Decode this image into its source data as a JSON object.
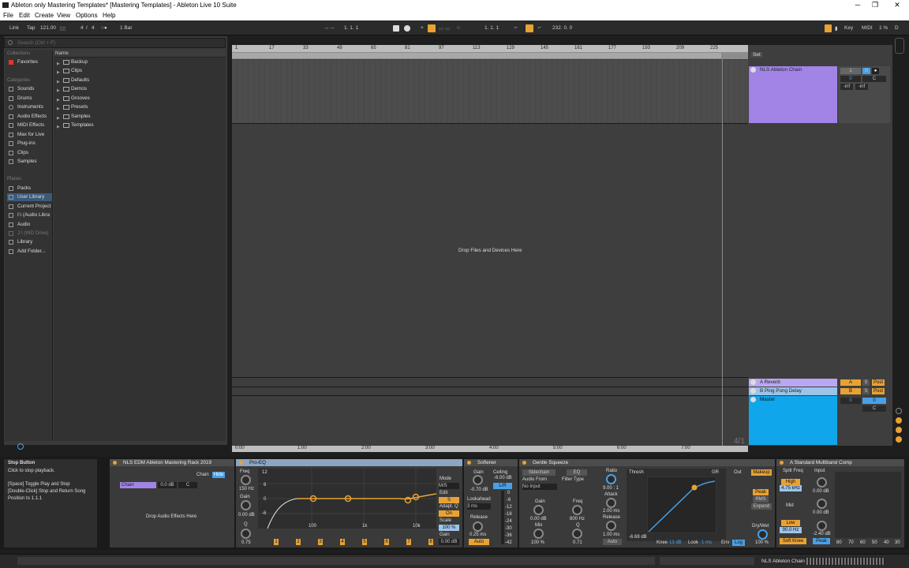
{
  "window": {
    "title": "Ableton only Mastering Templates*  [Mastering Templates] - Ableton Live 10 Suite",
    "minimize": "─",
    "restore": "❐",
    "close": "✕"
  },
  "menu": [
    "File",
    "Edit",
    "Create",
    "View",
    "Options",
    "Help"
  ],
  "transport": {
    "link": "Link",
    "tap": "Tap",
    "tempo": "121.00",
    "sig_num": "4",
    "sig_den": "4",
    "quantize": "1 Bar",
    "position": "1.    1.    1",
    "loop_start": "1.    1.    1",
    "loop_length": "232.    0.    0",
    "key": "Key",
    "midi": "MIDI",
    "cpu": "1 %",
    "d": "D"
  },
  "browser": {
    "search_placeholder": "Search (Ctrl + F)",
    "collections_header": "Collections",
    "favorites": "Favorites",
    "categories_header": "Categories",
    "categories": [
      "Sounds",
      "Drums",
      "Instruments",
      "Audio Effects",
      "MIDI Effects",
      "Max for Live",
      "Plug-ins",
      "Clips",
      "Samples"
    ],
    "places_header": "Places",
    "places": [
      "Packs",
      "User Library",
      "Current Project",
      "I:\\ (Audio Libra",
      "Audio",
      "J:\\ (WD Drive)",
      "Library",
      "Add Folder..."
    ],
    "name_header": "Name",
    "folders": [
      "Backup",
      "Clips",
      "Defaults",
      "Demos",
      "Grooves",
      "Presets",
      "Samples",
      "Templates"
    ]
  },
  "arrangement": {
    "ruler": [
      "1",
      "17",
      "33",
      "49",
      "65",
      "81",
      "97",
      "113",
      "129",
      "145",
      "161",
      "177",
      "193",
      "209",
      "225"
    ],
    "times": [
      "0:00",
      "1:00",
      "2:00",
      "3:00",
      "4:00",
      "5:00",
      "6:00",
      "7:00"
    ],
    "drop_text": "Drop Files and Devices Here",
    "time_sig": "4/1"
  },
  "tracks": {
    "set_label": "Set",
    "main": "NLS Ableton Chain",
    "return_a": "A Reverb",
    "return_b": "B Ping Pong Delay",
    "master": "Master",
    "vol_a": "0",
    "pan_c": "C",
    "inf1": "-inf",
    "inf2": "-inf",
    "send_a": "A",
    "send_b": "B",
    "solo": "S",
    "post": "Post",
    "master_vol": "0",
    "master_pan": "C",
    "track_num": "1",
    "track_s": "S"
  },
  "info": {
    "title": "Stop Button",
    "line1": "Click to stop playback.",
    "line2": "[Space] Toggle Play and Stop",
    "line3": "[Double-Click] Stop and Return Song",
    "line4": "Position to 1.1.1"
  },
  "rack": {
    "name": "NLS EDM Ableton Mastering Rack 2019",
    "chain_label": "Chain",
    "hide": "Hide",
    "chain_name": "Chain",
    "chain_db": "0.0 dB",
    "chain_pan": "C",
    "drop_text": "Drop Audio Effects Here"
  },
  "eq": {
    "name": "Pro-EQ",
    "freq_label": "Freq",
    "freq": "150 Hz",
    "gain_label": "Gain",
    "gain": "0.00 dB",
    "q_label": "Q",
    "q": "0.75",
    "db_ticks": [
      "12",
      "6",
      "0",
      "-6",
      "-12"
    ],
    "hz_ticks": [
      "100",
      "1k",
      "10k"
    ],
    "mode_label": "Mode",
    "mode": "M/S",
    "edit_label": "Edit",
    "edit": "S",
    "adapt_label": "Adapt. Q",
    "adapt": "On",
    "scale_label": "Scale",
    "scale": "100 %",
    "gain2_label": "Gain",
    "gain2": "0.00 dB",
    "bands": [
      "1",
      "2",
      "3",
      "4",
      "5",
      "6",
      "7",
      "8"
    ]
  },
  "softener": {
    "name": "Softener",
    "gain_label": "Gain",
    "gain": "-0.70 dB",
    "ceiling_label": "Ceiling",
    "ceiling": "-6.00 dB",
    "lr": "L/R",
    "lookahead_label": "Lookahead",
    "lookahead": "3 ms",
    "release_label": "Release",
    "release": "0.25 ms",
    "auto": "Auto",
    "scale": [
      "0",
      "-6",
      "-12",
      "-18",
      "-24",
      "-30",
      "-36",
      "-42"
    ]
  },
  "squeeze": {
    "name": "Gentle Squeeze",
    "sidechain": "Sidechain",
    "eq": "EQ",
    "audio_from_label": "Audio From",
    "audio_from": "No Input",
    "filter_label": "Filter Type",
    "gain_label": "Gain",
    "gain": "0.00 dB",
    "mix_label": "Mix",
    "mix": "100 %",
    "freq_label": "Freq",
    "freq": "800 Hz",
    "q_label": "Q",
    "q": "0.71",
    "ratio_label": "Ratio",
    "ratio": "9.00 : 1",
    "attack_label": "Attack",
    "attack": "2.00 ms",
    "release_label": "Release",
    "release": "1.00 ms",
    "auto": "Auto",
    "thresh_label": "Thresh",
    "gr_label": "GR",
    "out_label": "Out",
    "thresh": "-6.68 dB",
    "knee_label": "Knee",
    "knee": "13 dB",
    "look_label": "Look",
    "look": "1 ms",
    "env_label": "Env",
    "env": "Log",
    "makeup": "Makeup",
    "peak": "Peak",
    "rms": "RMS",
    "expand": "Expand",
    "drywet_label": "Dry/Wet",
    "drywet": "100 %"
  },
  "multiband": {
    "name": "A Standard Multiband Comp",
    "split_label": "Split Freq",
    "input_label": "Input",
    "high": "High",
    "high_freq": "4.75 kHz",
    "high_in": "0.00 dB",
    "mid": "Mid",
    "mid_in": "0.00 dB",
    "low": "Low",
    "low_freq": "90.0 Hz",
    "low_in": "-2.40 dB",
    "soft_knee": "Soft Knee",
    "peak": "Peak",
    "scale": [
      "80",
      "70",
      "60",
      "50",
      "40",
      "30"
    ]
  },
  "status": {
    "chain": "NLS Ableton Chain"
  }
}
